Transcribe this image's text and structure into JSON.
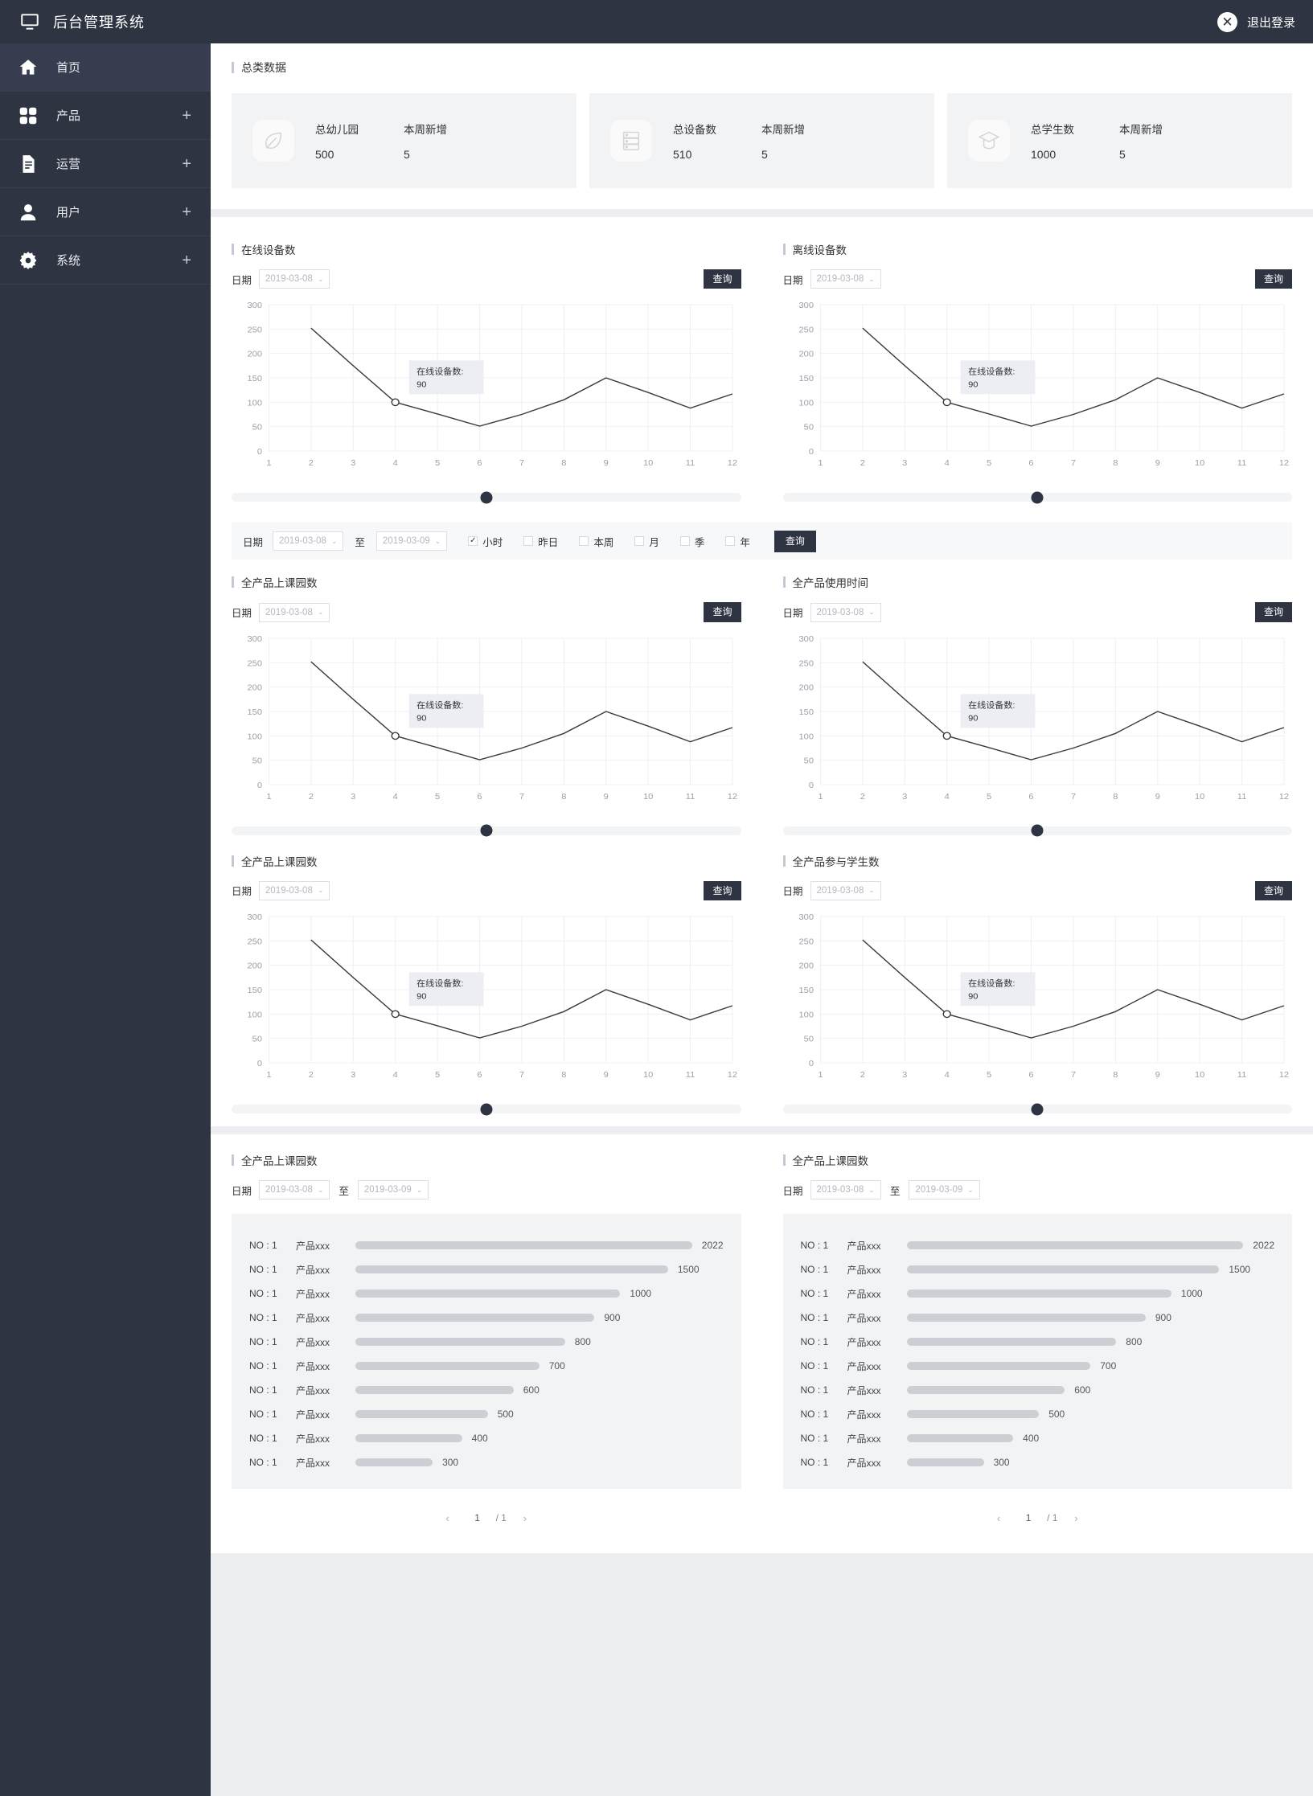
{
  "header": {
    "title": "后台管理系统",
    "logout_label": "退出登录",
    "logout_icon": "close-circle-icon",
    "monitor_icon": "monitor-icon"
  },
  "sidebar": {
    "items": [
      {
        "label": "首页",
        "icon": "home-icon",
        "expandable": false,
        "active": true
      },
      {
        "label": "产品",
        "icon": "grid-icon",
        "expandable": true,
        "plus": "+",
        "active": false
      },
      {
        "label": "运营",
        "icon": "document-icon",
        "expandable": true,
        "plus": "+",
        "active": false
      },
      {
        "label": "用户",
        "icon": "user-icon",
        "expandable": true,
        "plus": "+",
        "active": false
      },
      {
        "label": "系统",
        "icon": "gear-icon",
        "expandable": true,
        "plus": "+",
        "active": false
      }
    ]
  },
  "summary": {
    "title": "总类数据",
    "cards": [
      {
        "icon": "leaf-icon",
        "key1": "总幼儿园",
        "key2": "本周新增",
        "val1": "500",
        "val2": "5"
      },
      {
        "icon": "server-icon",
        "key1": "总设备数",
        "key2": "本周新增",
        "val1": "510",
        "val2": "5"
      },
      {
        "icon": "graduation-icon",
        "key1": "总学生数",
        "key2": "本周新增",
        "val1": "1000",
        "val2": "5"
      }
    ]
  },
  "common": {
    "date_label": "日期",
    "to_label": "至",
    "query_label": "查询",
    "date_start": "2019-03-08",
    "date_end": "2019-03-09",
    "caret": "⌄"
  },
  "filterbar": {
    "date_label": "日期",
    "date_start": "2019-03-08",
    "to_label": "至",
    "date_end": "2019-03-09",
    "query_label": "查询",
    "checkboxes": [
      {
        "label": "小时",
        "checked": true
      },
      {
        "label": "昨日",
        "checked": false
      },
      {
        "label": "本周",
        "checked": false
      },
      {
        "label": "月",
        "checked": false
      },
      {
        "label": "季",
        "checked": false
      },
      {
        "label": "年",
        "checked": false
      }
    ]
  },
  "charts": [
    {
      "title": "在线设备数",
      "date": "2019-03-08",
      "query_label": "查询"
    },
    {
      "title": "离线设备数",
      "date": "2019-03-08",
      "query_label": "查询"
    },
    {
      "title": "全产品上课园数",
      "date": "2019-03-08",
      "query_label": "查询"
    },
    {
      "title": "全产品使用时间",
      "date": "2019-03-08",
      "query_label": "查询"
    },
    {
      "title": "全产品上课园数",
      "date": "2019-03-08",
      "query_label": "查询"
    },
    {
      "title": "全产品参与学生数",
      "date": "2019-03-08",
      "query_label": "查询"
    }
  ],
  "chart_data": {
    "type": "line",
    "title": "在线设备数",
    "xlabel": "",
    "ylabel": "",
    "x": [
      1,
      2,
      3,
      4,
      5,
      6,
      7,
      8,
      9,
      10,
      11,
      12
    ],
    "xticklabels": [
      "1",
      "2",
      "3",
      "4",
      "5",
      "6",
      "7",
      "8",
      "9",
      "10",
      "11",
      "12"
    ],
    "yticklabels": [
      "0",
      "50",
      "100",
      "150",
      "200",
      "250",
      "300"
    ],
    "ylim": [
      0,
      300
    ],
    "ytick_step": 50,
    "grid": true,
    "legend": "none",
    "series": [
      {
        "name": "在线设备数",
        "values": [
          null,
          252,
          175,
          100,
          76,
          51,
          75,
          105,
          150,
          120,
          88,
          117
        ]
      }
    ],
    "marker_point": {
      "x": 4,
      "y": 100
    },
    "tooltip": {
      "label": "在线设备数:",
      "value": "90"
    },
    "slider_position": 0.5,
    "repeated_in_panels": 6
  },
  "ranks": [
    {
      "title": "全产品上课园数",
      "date_label": "日期",
      "date_start": "2019-03-08",
      "to_label": "至",
      "date_end": "2019-03-09",
      "rows": [
        {
          "no": "NO : 1",
          "name": "产品xxx",
          "value": "2022",
          "pct": 100
        },
        {
          "no": "NO : 1",
          "name": "产品xxx",
          "value": "1500",
          "pct": 85
        },
        {
          "no": "NO : 1",
          "name": "产品xxx",
          "value": "1000",
          "pct": 72
        },
        {
          "no": "NO : 1",
          "name": "产品xxx",
          "value": "900",
          "pct": 65
        },
        {
          "no": "NO : 1",
          "name": "产品xxx",
          "value": "800",
          "pct": 57
        },
        {
          "no": "NO : 1",
          "name": "产品xxx",
          "value": "700",
          "pct": 50
        },
        {
          "no": "NO : 1",
          "name": "产品xxx",
          "value": "600",
          "pct": 43
        },
        {
          "no": "NO : 1",
          "name": "产品xxx",
          "value": "500",
          "pct": 36
        },
        {
          "no": "NO : 1",
          "name": "产品xxx",
          "value": "400",
          "pct": 29
        },
        {
          "no": "NO : 1",
          "name": "产品xxx",
          "value": "300",
          "pct": 21
        }
      ],
      "pager": {
        "prev": "‹",
        "page": "1",
        "sep": "/ 1",
        "next": "›"
      }
    },
    {
      "title": "全产品上课园数",
      "date_label": "日期",
      "date_start": "2019-03-08",
      "to_label": "至",
      "date_end": "2019-03-09",
      "rows": [
        {
          "no": "NO : 1",
          "name": "产品xxx",
          "value": "2022",
          "pct": 100
        },
        {
          "no": "NO : 1",
          "name": "产品xxx",
          "value": "1500",
          "pct": 85
        },
        {
          "no": "NO : 1",
          "name": "产品xxx",
          "value": "1000",
          "pct": 72
        },
        {
          "no": "NO : 1",
          "name": "产品xxx",
          "value": "900",
          "pct": 65
        },
        {
          "no": "NO : 1",
          "name": "产品xxx",
          "value": "800",
          "pct": 57
        },
        {
          "no": "NO : 1",
          "name": "产品xxx",
          "value": "700",
          "pct": 50
        },
        {
          "no": "NO : 1",
          "name": "产品xxx",
          "value": "600",
          "pct": 43
        },
        {
          "no": "NO : 1",
          "name": "产品xxx",
          "value": "500",
          "pct": 36
        },
        {
          "no": "NO : 1",
          "name": "产品xxx",
          "value": "400",
          "pct": 29
        },
        {
          "no": "NO : 1",
          "name": "产品xxx",
          "value": "300",
          "pct": 21
        }
      ],
      "pager": {
        "prev": "‹",
        "page": "1",
        "sep": "/ 1",
        "next": "›"
      }
    }
  ],
  "colors": {
    "sidebar_bg": "#2f3443",
    "page_bg": "#eceef2",
    "panel_bg": "#ffffff",
    "card_bg": "#f2f3f5",
    "accent": "#2f3443",
    "line": "#3b3b3b",
    "bar": "#cdcfd4"
  }
}
